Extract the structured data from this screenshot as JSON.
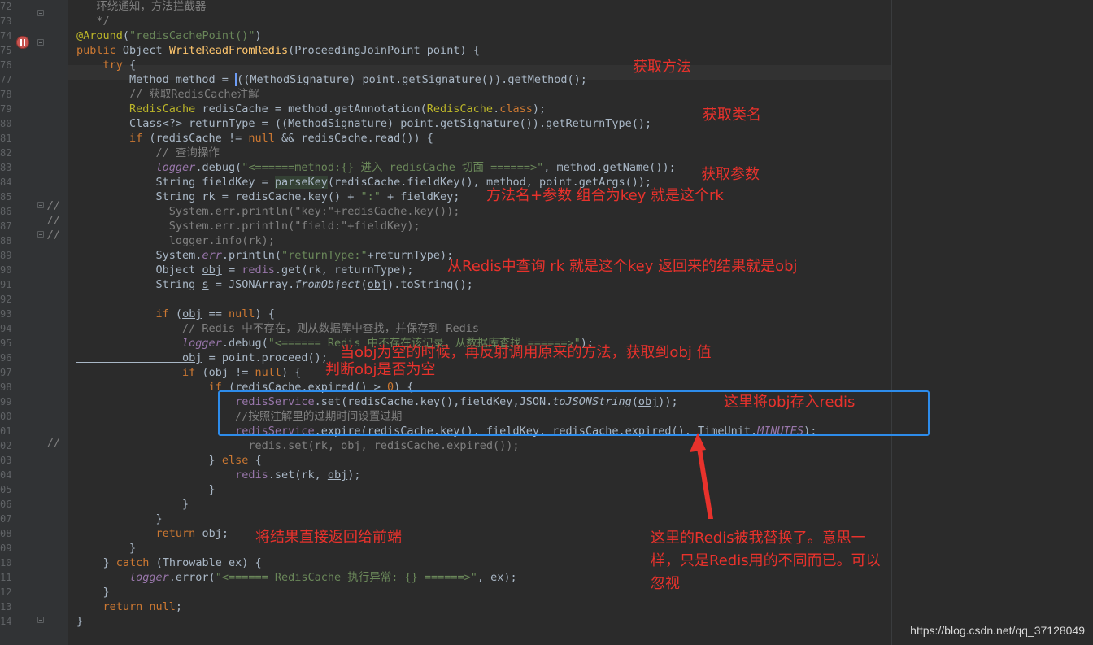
{
  "gutter": {
    "line_numbers": [
      "72",
      "73",
      "74",
      "75",
      "76",
      "77",
      "78",
      "79",
      "80",
      "81",
      "82",
      "83",
      "84",
      "85",
      "86",
      "87",
      "88",
      "89",
      "90",
      "91",
      "92",
      "93",
      "94",
      "95",
      "96",
      "97",
      "98",
      "99",
      "00",
      "01",
      "02",
      "03",
      "04",
      "05",
      "06",
      "07",
      "08",
      "09",
      "10",
      "11",
      "12",
      "13",
      "14"
    ],
    "comment_slashes": [
      "//",
      "//",
      "//",
      "//"
    ]
  },
  "code": [
    [
      [
        "com",
        "   环绕通知，方法拦截器"
      ]
    ],
    [
      [
        "com",
        "   */"
      ]
    ],
    [
      [
        "ann",
        "@Around"
      ],
      [
        "",
        "("
      ],
      [
        "str",
        "\"redisCachePoint()\""
      ],
      [
        "",
        ")"
      ]
    ],
    [
      [
        "kw",
        "public "
      ],
      [
        "",
        "Object "
      ],
      [
        "fn",
        "WriteReadFromRedis"
      ],
      [
        "",
        "(ProceedingJoinPoint point) {"
      ]
    ],
    [
      [
        "kw",
        "    try "
      ],
      [
        "",
        "{"
      ]
    ],
    [
      [
        "",
        "        Method method = "
      ],
      [
        "caret",
        ""
      ],
      [
        "",
        "((MethodSignature) point.getSignature()).getMethod();"
      ]
    ],
    [
      [
        "com",
        "        // 获取RedisCache注解"
      ]
    ],
    [
      [
        "ann",
        "        RedisCache "
      ],
      [
        "",
        "redisCache = method.getAnnotation("
      ],
      [
        "ann",
        "RedisCache"
      ],
      [
        "",
        "."
      ],
      [
        "kw",
        "class"
      ],
      [
        "",
        ");"
      ]
    ],
    [
      [
        "",
        "        Class<?> returnType = ((MethodSignature) point.getSignature()).getReturnType();"
      ]
    ],
    [
      [
        "kw",
        "        if "
      ],
      [
        "",
        "(redisCache != "
      ],
      [
        "kw",
        "null "
      ],
      [
        "",
        "&& redisCache.read()) {"
      ]
    ],
    [
      [
        "com",
        "            // 查询操作"
      ]
    ],
    [
      [
        "fldi",
        "            logger"
      ],
      [
        "",
        ".debug("
      ],
      [
        "str",
        "\"<======method:{} 进入 redisCache 切面 ======>\""
      ],
      [
        "",
        ", method.getName());"
      ]
    ],
    [
      [
        "",
        "            String fieldKey = "
      ],
      [
        "hlbg",
        "parseKey"
      ],
      [
        "",
        "(redisCache.fieldKey(), method, point.getArgs());"
      ]
    ],
    [
      [
        "",
        "            String rk = redisCache.key() + "
      ],
      [
        "str",
        "\":\""
      ],
      [
        "",
        " + fieldKey;"
      ]
    ],
    [
      [
        "com",
        "              System.err.println(\"key:\"+redisCache.key());"
      ]
    ],
    [
      [
        "com",
        "              System.err.println(\"field:\"+fieldKey);"
      ]
    ],
    [
      [
        "com",
        "              logger.info(rk);"
      ]
    ],
    [
      [
        "",
        "            System."
      ],
      [
        "fldi",
        "err"
      ],
      [
        "",
        ".println("
      ],
      [
        "str",
        "\"returnType:\""
      ],
      [
        "",
        "+returnType);"
      ]
    ],
    [
      [
        "",
        "            Object "
      ],
      [
        "ul",
        "obj"
      ],
      [
        "",
        " = "
      ],
      [
        "fld",
        "redis"
      ],
      [
        "",
        ".get(rk, returnType);"
      ]
    ],
    [
      [
        "",
        "            String "
      ],
      [
        "ul",
        "s"
      ],
      [
        "",
        " = JSONArray."
      ],
      [
        "ital",
        "fromObject"
      ],
      [
        "",
        "("
      ],
      [
        "ul",
        "obj"
      ],
      [
        "",
        ").toString();"
      ]
    ],
    [
      [
        "",
        ""
      ]
    ],
    [
      [
        "kw",
        "            if "
      ],
      [
        "",
        "("
      ],
      [
        "ul",
        "obj"
      ],
      [
        "",
        " == "
      ],
      [
        "kw",
        "null"
      ],
      [
        "",
        ") {"
      ]
    ],
    [
      [
        "com",
        "                // Redis 中不存在，则从数据库中查找，并保存到 Redis"
      ]
    ],
    [
      [
        "fldi",
        "                logger"
      ],
      [
        "",
        ".debug("
      ],
      [
        "str",
        "\"<====== Redis 中不存在该记录，从数据库查找 ======>\""
      ],
      [
        "",
        ");"
      ]
    ],
    [
      [
        "ul",
        "                obj"
      ],
      [
        "",
        " = point.proceed();"
      ]
    ],
    [
      [
        "kw",
        "                if "
      ],
      [
        "",
        "("
      ],
      [
        "ul",
        "obj"
      ],
      [
        "",
        " != "
      ],
      [
        "kw",
        "null"
      ],
      [
        "",
        ") {"
      ]
    ],
    [
      [
        "kw",
        "                    if "
      ],
      [
        "",
        "(redisCache.expired() > "
      ],
      [
        "num",
        "0"
      ],
      [
        "",
        ") {"
      ]
    ],
    [
      [
        "fld",
        "                        redisService"
      ],
      [
        "",
        ".set(redisCache.key(),fieldKey,JSON."
      ],
      [
        "ital",
        "toJSONString"
      ],
      [
        "",
        "("
      ],
      [
        "ul",
        "obj"
      ],
      [
        "",
        "));"
      ]
    ],
    [
      [
        "com",
        "                        //按照注解里的过期时间设置过期"
      ]
    ],
    [
      [
        "fld",
        "                        redisService"
      ],
      [
        "",
        ".expire(redisCache.key(), fieldKey, redisCache.expired(), TimeUnit."
      ],
      [
        "fldi",
        "MINUTES"
      ],
      [
        "",
        ");"
      ]
    ],
    [
      [
        "com",
        "                          redis.set(rk, obj, redisCache.expired());"
      ]
    ],
    [
      [
        "",
        "                    } "
      ],
      [
        "kw",
        "else "
      ],
      [
        "",
        "{"
      ]
    ],
    [
      [
        "fld",
        "                        redis"
      ],
      [
        "",
        ".set(rk, "
      ],
      [
        "ul",
        "obj"
      ],
      [
        "",
        ");"
      ]
    ],
    [
      [
        "",
        "                    }"
      ]
    ],
    [
      [
        "",
        "                }"
      ]
    ],
    [
      [
        "",
        "            }"
      ]
    ],
    [
      [
        "kw",
        "            return "
      ],
      [
        "ul",
        "obj"
      ],
      [
        "",
        ";"
      ]
    ],
    [
      [
        "",
        "        }"
      ]
    ],
    [
      [
        "",
        "    } "
      ],
      [
        "kw",
        "catch "
      ],
      [
        "",
        "(Throwable ex) {"
      ]
    ],
    [
      [
        "fldi",
        "        logger"
      ],
      [
        "",
        ".error("
      ],
      [
        "str",
        "\"<====== RedisCache 执行异常: {} ======>\""
      ],
      [
        "",
        ", ex);"
      ]
    ],
    [
      [
        "",
        "    }"
      ]
    ],
    [
      [
        "kw",
        "    return null"
      ],
      [
        "",
        ";"
      ]
    ],
    [
      [
        "",
        "}"
      ]
    ]
  ],
  "annotations": {
    "get_method": "获取方法",
    "get_class_name": "获取类名",
    "get_params": "获取参数",
    "key_combo": "方法名+参数   组合为key    就是这个rk",
    "query_redis": "从Redis中查询  rk  就是这个key   返回来的结果就是obj",
    "when_null": "当obj为空的时候，再反射调用原来的方法，获取到obj  值",
    "check_null": "判断obj是否为空",
    "store_redis": "这里将obj存入redis",
    "return_front": "将结果直接返回给前端",
    "replaced_note": "这里的Redis被我替换了。意思一样，只是Redis用的不同而已。可以忽视"
  },
  "watermark": "https://blog.csdn.net/qq_37128049",
  "colors": {
    "background": "#2b2b2b",
    "gutter": "#313335",
    "annotation_red": "#e8322c",
    "box_blue": "#2d8ceb",
    "keyword": "#cc7832",
    "string": "#6a8759",
    "comment": "#808080"
  }
}
